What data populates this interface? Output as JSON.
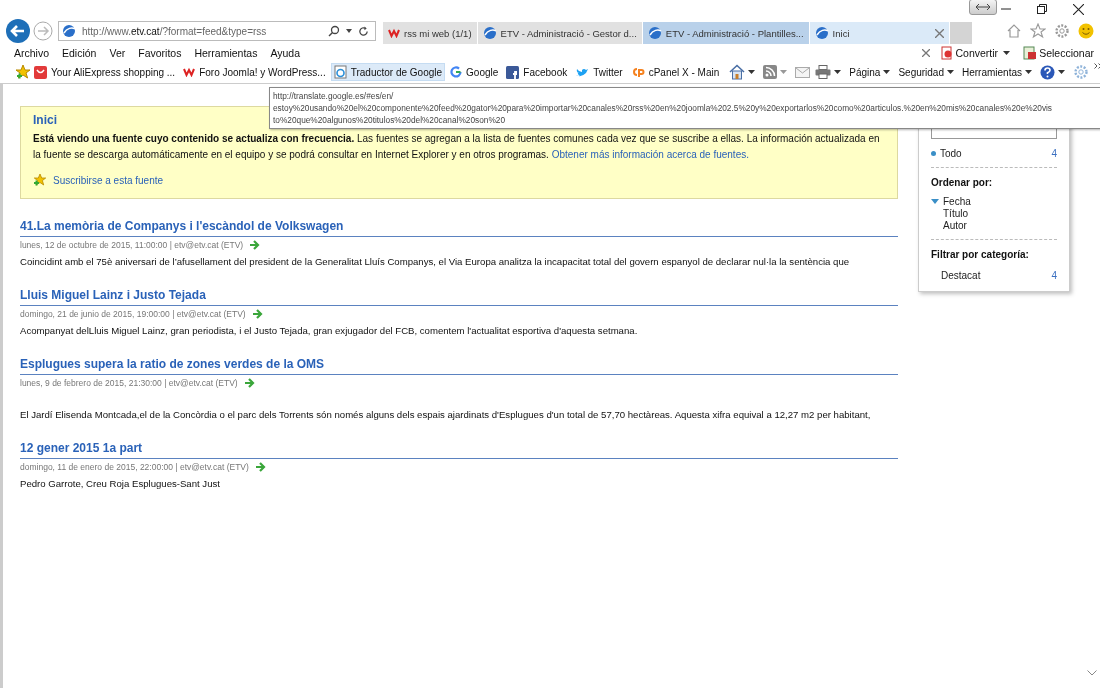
{
  "address_bar": {
    "url": "http://www.**etv.cat**/?format=feed&type=rss"
  },
  "tabs": [
    {
      "label": "rss mi web (1/1)",
      "selected": false,
      "hovered": false
    },
    {
      "label": "ETV - Administració - Gestor d...",
      "selected": false,
      "hovered": false
    },
    {
      "label": "ETV - Administració - Plantilles...",
      "selected": false,
      "hovered": true
    },
    {
      "label": "Inici",
      "selected": true,
      "hovered": false
    }
  ],
  "menu_bar": {
    "items": [
      "Archivo",
      "Edición",
      "Ver",
      "Favoritos",
      "Herramientas",
      "Ayuda"
    ],
    "addon": [
      "Convertir",
      "Seleccionar"
    ]
  },
  "favorites_bar": [
    {
      "label": "Your AliExpress shopping ...",
      "hovered": false
    },
    {
      "label": "Foro Joomla! y WordPress...",
      "hovered": false
    },
    {
      "label": "Traductor de Google",
      "hovered": true
    },
    {
      "label": "Google",
      "hovered": false
    },
    {
      "label": "Facebook",
      "hovered": false
    },
    {
      "label": "Twitter",
      "hovered": false
    },
    {
      "label": "cPanel X - Main",
      "hovered": false
    }
  ],
  "command_bar": [
    "Página",
    "Seguridad",
    "Herramientas"
  ],
  "tooltip": {
    "lines": [
      "http://translate.google.es/#es/en/",
      "estoy%20usando%20el%20componente%20feed%20gator%20para%20importar%20canales%20rss%20en%20joomla%202.5%20y%20exportarlos%20como%20articulos.%20en%20mis%20canales%20e%20vis",
      "to%20que%20algunos%20titulos%20del%20canal%20son%20"
    ]
  },
  "feed_notice": {
    "title": "Inici",
    "text": "**Está viendo una fuente cuyo contenido se actualiza con frecuencia.** Las fuentes se agregan a la lista de fuentes comunes cada vez que se suscribe a ellas. La información actualizada en la fuente se descarga automáticamente en el equipo y se podrá consultar en Internet Explorer y en otros programas.",
    "link": "Obtener más información acerca de fuentes.",
    "subscribe": "Suscribirse a esta fuente"
  },
  "items": [
    {
      "title": "41.La memòria de Companys i l'escàndol de Volkswagen",
      "meta": "lunes, 12 de octubre de 2015, 11:00:00 | etv@etv.cat (ETV)",
      "body": "Coincidint amb el 75è aniversari de l’afusellament del president de la Generalitat Lluís Companys, el Via Europa analitza la incapacitat total del govern espanyol de declarar nul·la la sentència que"
    },
    {
      "title": "Lluis Miguel Lainz i Justo Tejada",
      "meta": "domingo, 21 de junio de 2015, 19:00:00 | etv@etv.cat (ETV)",
      "body": "Acompanyat delLluis Miguel Lainz, gran periodista, i el Justo Tejada, gran exjugador del FCB, comentem l'actualitat esportiva d'aquesta setmana."
    },
    {
      "title": "Esplugues supera la ratio de zones verdes de la OMS",
      "meta": "lunes, 9 de febrero de 2015, 21:30:00 | etv@etv.cat (ETV)",
      "body": "El Jardí Elisenda Montcada,el de la Concòrdia o el parc dels Torrents són només alguns dels espais ajardinats d'Esplugues d'un total de 57,70 hectàreas. Aquesta xifra equival a 12,27 m2 per habitant,"
    },
    {
      "title": "12 gener 2015 1a part",
      "meta": "domingo, 11 de enero de 2015, 22:00:00 | etv@etv.cat (ETV)",
      "body": "Pedro Garrote, Creu Roja Esplugues-Sant Just"
    }
  ],
  "sidebar": {
    "filter_all": {
      "label": "Todo",
      "count": "4"
    },
    "sort_heading": "Ordenar por:",
    "sort_options": [
      {
        "label": "Fecha",
        "selected": true
      },
      {
        "label": "Título",
        "selected": false
      },
      {
        "label": "Autor",
        "selected": false
      }
    ],
    "category_heading": "Filtrar por categoría:",
    "categories": [
      {
        "label": "Destacat",
        "count": "4"
      }
    ]
  }
}
